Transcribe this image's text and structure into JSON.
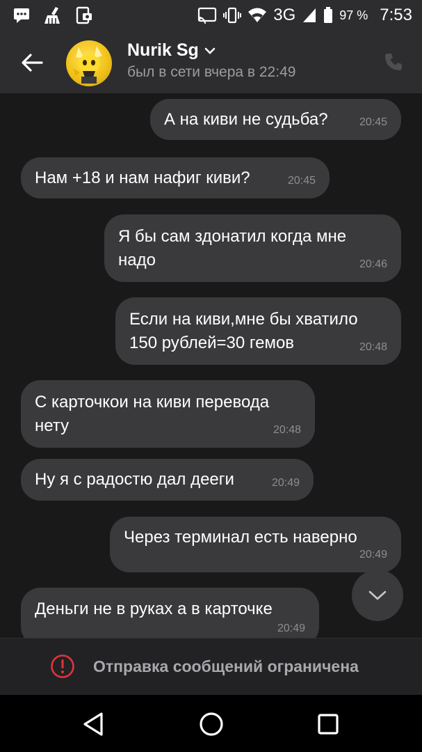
{
  "status_bar": {
    "battery": "97 %",
    "time": "7:53",
    "network": "3G"
  },
  "contact": {
    "name": "Nurik Sg",
    "last_seen": "был в сети вчера в 22:49"
  },
  "messages": [
    {
      "text": "А на киви не судьба?",
      "time": "20:45",
      "direction": "out"
    },
    {
      "text": "Нам +18 и нам нафиг киви?",
      "time": "20:45",
      "direction": "in"
    },
    {
      "text": "Я бы сам здонатил когда мне надо",
      "time": "20:46",
      "direction": "out"
    },
    {
      "text": "Если на киви,мне бы хватило 150 рублей=30 гемов",
      "time": "20:48",
      "direction": "out"
    },
    {
      "text": "С карточкои на киви перевода нету",
      "time": "20:48",
      "direction": "in"
    },
    {
      "text": "Ну я с радостю дал дееги",
      "time": "20:49",
      "direction": "in"
    },
    {
      "text": "Через терминал есть наверно",
      "time": "20:49",
      "direction": "out"
    },
    {
      "text": "Деньги не в руках а в карточке",
      "time": "20:49",
      "direction": "in"
    }
  ],
  "restriction": {
    "text": "Отправка сообщений ограничена"
  },
  "colors": {
    "bubble": "#3a3a3c",
    "header": "#2d2d2f",
    "background": "#19191a",
    "alert": "#e0343c"
  },
  "icons": {
    "back": "arrow-left-icon",
    "call": "phone-icon",
    "scroll": "chevron-down-icon",
    "alert": "exclamation-circle-icon"
  }
}
